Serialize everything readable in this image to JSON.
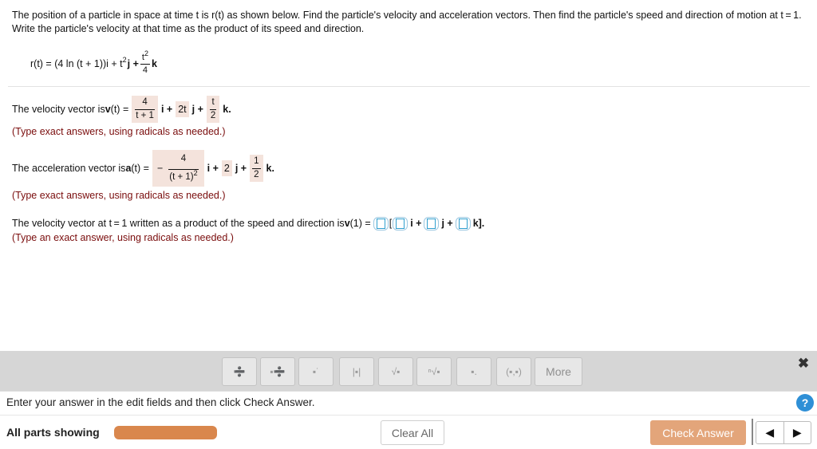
{
  "problem": {
    "text": "The position of a particle in space at time t is r(t) as shown below. Find the particle's velocity and acceleration vectors. Then find the particle's speed and direction of motion at t = 1. Write the particle's velocity at that time as the product of its speed and direction."
  },
  "position": {
    "lhs": "r(t) = (4 ln (t + 1))i + t",
    "t_exp": "2",
    "j_part": "j + ",
    "k_num": "t",
    "k_num_exp": "2",
    "k_den": "4",
    "k_part": "k"
  },
  "velocity": {
    "prefix": "The velocity vector is ",
    "bold_v": "v",
    "lhs": "(t) =",
    "i_num": "4",
    "i_den": "t + 1",
    "i_part": "i +",
    "j_val": "2t",
    "j_part": "j +",
    "k_num": "t",
    "k_den": "2",
    "k_part": "k.",
    "hint": "(Type exact answers, using radicals as needed.)"
  },
  "acceleration": {
    "prefix": "The acceleration vector is ",
    "bold_a": "a",
    "lhs": "(t) =",
    "minus": "−",
    "i_num": "4",
    "i_den": "(t + 1)",
    "i_den_exp": "2",
    "i_part": "i +",
    "j_val": "2",
    "j_part": "j +",
    "k_num": "1",
    "k_den": "2",
    "k_part": "k.",
    "hint": "(Type exact answers, using radicals as needed.)"
  },
  "product": {
    "prefix": "The velocity vector at t = 1 written as a product of the speed and direction is ",
    "bold_v": "v",
    "lhs": "(1) =",
    "bracket_open": "[",
    "i_part": "i +",
    "j_part": "j +",
    "k_part": "k].",
    "hint": "(Type an exact answer, using radicals as needed.)"
  },
  "toolbar": {
    "buttons": [
      {
        "icon": "fraction-icon",
        "glyph": "➗"
      },
      {
        "icon": "mixed-number-icon",
        "glyph": "▪➗"
      },
      {
        "icon": "exponent-icon",
        "glyph": "▪˙"
      },
      {
        "icon": "absolute-value-icon",
        "glyph": "|▪|"
      },
      {
        "icon": "square-root-icon",
        "glyph": "√▪"
      },
      {
        "icon": "nth-root-icon",
        "glyph": "ⁿ√▪"
      },
      {
        "icon": "decimal-icon",
        "glyph": "▪."
      },
      {
        "icon": "ordered-pair-icon",
        "glyph": "(▪,▪)"
      }
    ],
    "more_label": "More",
    "close_glyph": "✖"
  },
  "status": {
    "instruction": "Enter your answer in the edit fields and then click Check Answer.",
    "help_glyph": "?"
  },
  "footer": {
    "parts_label": "All parts showing",
    "progress_fraction": 1.0,
    "clear_all_label": "Clear All",
    "check_answer_label": "Check Answer",
    "prev_glyph": "◀",
    "next_glyph": "▶"
  },
  "colors": {
    "answer_highlight": "#f4e3dc",
    "hint_text": "#7a0d0d",
    "progress_fill": "#d9874d",
    "check_answer_bg": "#e3a57a",
    "help_bg": "#2e8fd6",
    "input_border": "#2f9fcf"
  }
}
